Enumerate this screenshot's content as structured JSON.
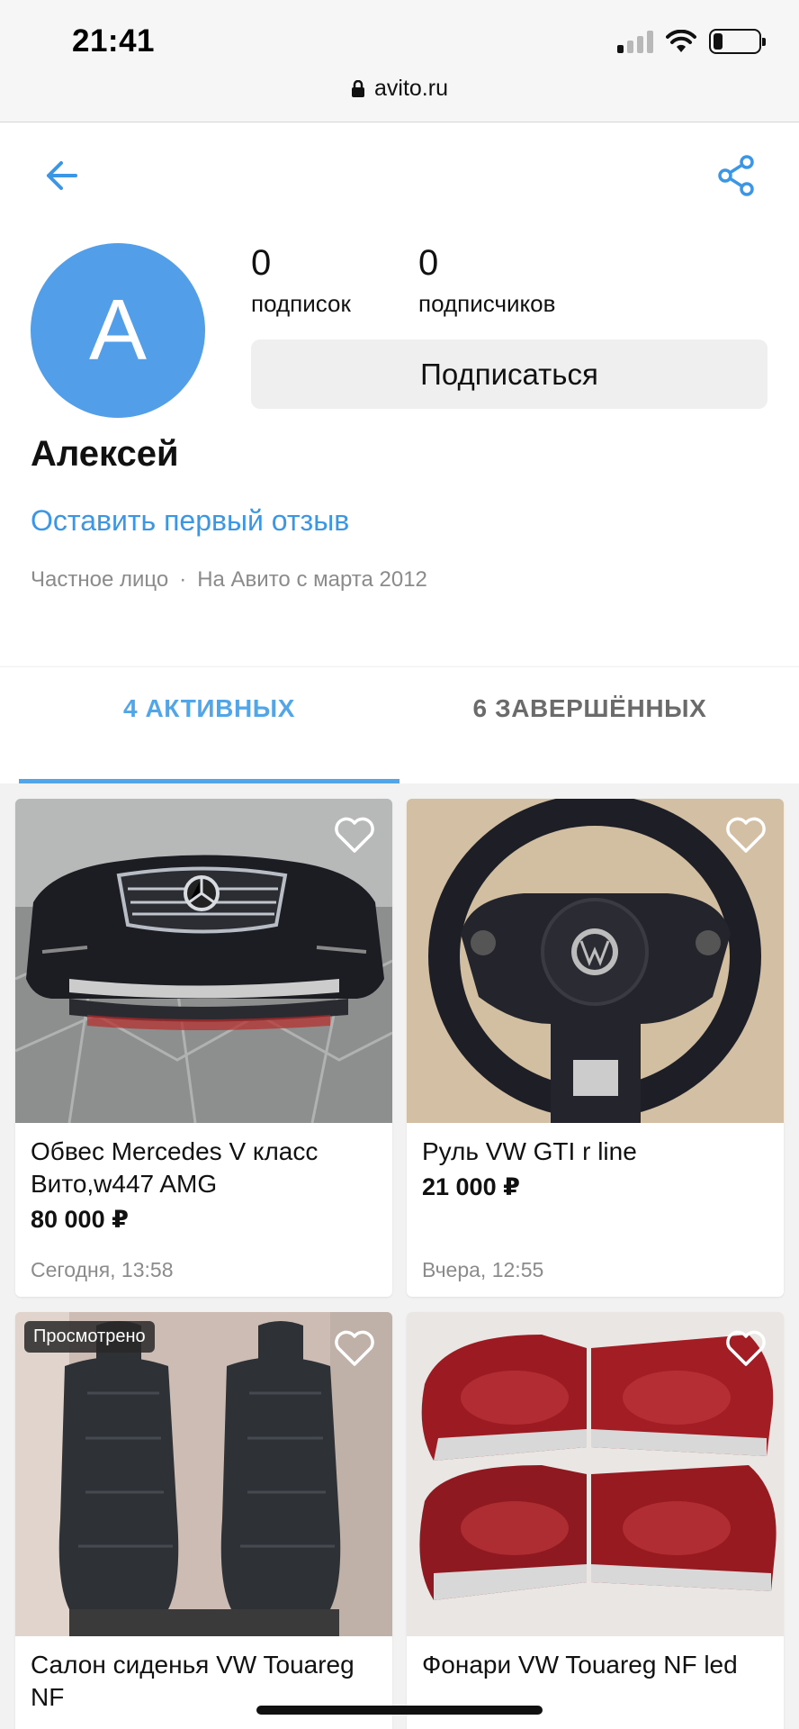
{
  "status_bar": {
    "time": "21:41",
    "battery_level": 0.2
  },
  "browser": {
    "url": "avito.ru",
    "lock_icon": "lock-icon"
  },
  "header": {
    "back_icon": "arrow-left-icon",
    "share_icon": "share-icon"
  },
  "profile": {
    "avatar_letter": "А",
    "avatar_color": "#529ee9",
    "subscriptions_count": "0",
    "subscriptions_label": "подписок",
    "subscribers_count": "0",
    "subscribers_label": "подписчиков",
    "subscribe_label": "Подписаться",
    "name": "Алексей",
    "review_link": "Оставить первый отзыв",
    "seller_type": "Частное лицо",
    "separator": "·",
    "member_since": "На Авито с марта 2012"
  },
  "tabs": [
    {
      "label": "4 АКТИВНЫХ",
      "active": true
    },
    {
      "label": "6 ЗАВЕРШЁННЫХ",
      "active": false
    }
  ],
  "accent_color": "#51a6e9",
  "listings": [
    {
      "title": "Обвес Mercedes V класс Вито,w447 AMG",
      "price": "80 000 ₽",
      "date": "Сегодня, 13:58",
      "badge": "",
      "image": "bumper-photo"
    },
    {
      "title": "Руль VW GTI r line",
      "price": "21 000 ₽",
      "date": "Вчера, 12:55",
      "badge": "",
      "image": "steering-wheel-photo"
    },
    {
      "title": "Салон сиденья VW Touareg NF",
      "price": "",
      "date": "",
      "badge": "Просмотрено",
      "image": "car-seats-photo"
    },
    {
      "title": "Фонари VW Touareg NF led",
      "price": "",
      "date": "",
      "badge": "",
      "image": "tail-lights-photo"
    }
  ]
}
